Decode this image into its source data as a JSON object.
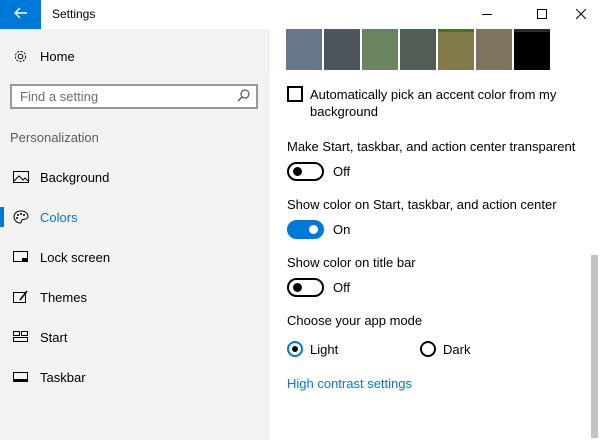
{
  "window": {
    "title": "Settings",
    "back_icon": "arrow-left-icon",
    "accent": "#0078d7"
  },
  "nav": {
    "home_label": "Home",
    "search_placeholder": "Find a setting",
    "section_title": "Personalization",
    "items": [
      {
        "label": "Background",
        "icon": "image-icon",
        "active": false
      },
      {
        "label": "Colors",
        "icon": "palette-icon",
        "active": true
      },
      {
        "label": "Lock screen",
        "icon": "lock-screen-icon",
        "active": false
      },
      {
        "label": "Themes",
        "icon": "themes-brush-icon",
        "active": false
      },
      {
        "label": "Start",
        "icon": "start-tiles-icon",
        "active": false
      },
      {
        "label": "Taskbar",
        "icon": "taskbar-icon",
        "active": false
      }
    ]
  },
  "content": {
    "swatches": [
      {
        "color": "#68768a",
        "strip": "#6a7789"
      },
      {
        "color": "#4c5459",
        "strip": "#4c5a62"
      },
      {
        "color": "#6b8560",
        "strip": "#64806a"
      },
      {
        "color": "#525d54",
        "strip": "#486157"
      },
      {
        "color": "#837a4b",
        "strip": "#3f7a1f"
      },
      {
        "color": "#7e735f",
        "strip": "#7e735f"
      },
      {
        "color": "#000000",
        "strip": "#2b2b2b"
      }
    ],
    "auto_accent_label": "Automatically pick an accent color from my background",
    "transparent_label": "Make Start, taskbar, and action center transparent",
    "transparent_state": "Off",
    "show_color_start_label": "Show color on Start, taskbar, and action center",
    "show_color_start_state": "On",
    "show_color_title_label": "Show color on title bar",
    "show_color_title_state": "Off",
    "app_mode_label": "Choose your app mode",
    "app_mode_light": "Light",
    "app_mode_dark": "Dark",
    "high_contrast_link": "High contrast settings"
  }
}
